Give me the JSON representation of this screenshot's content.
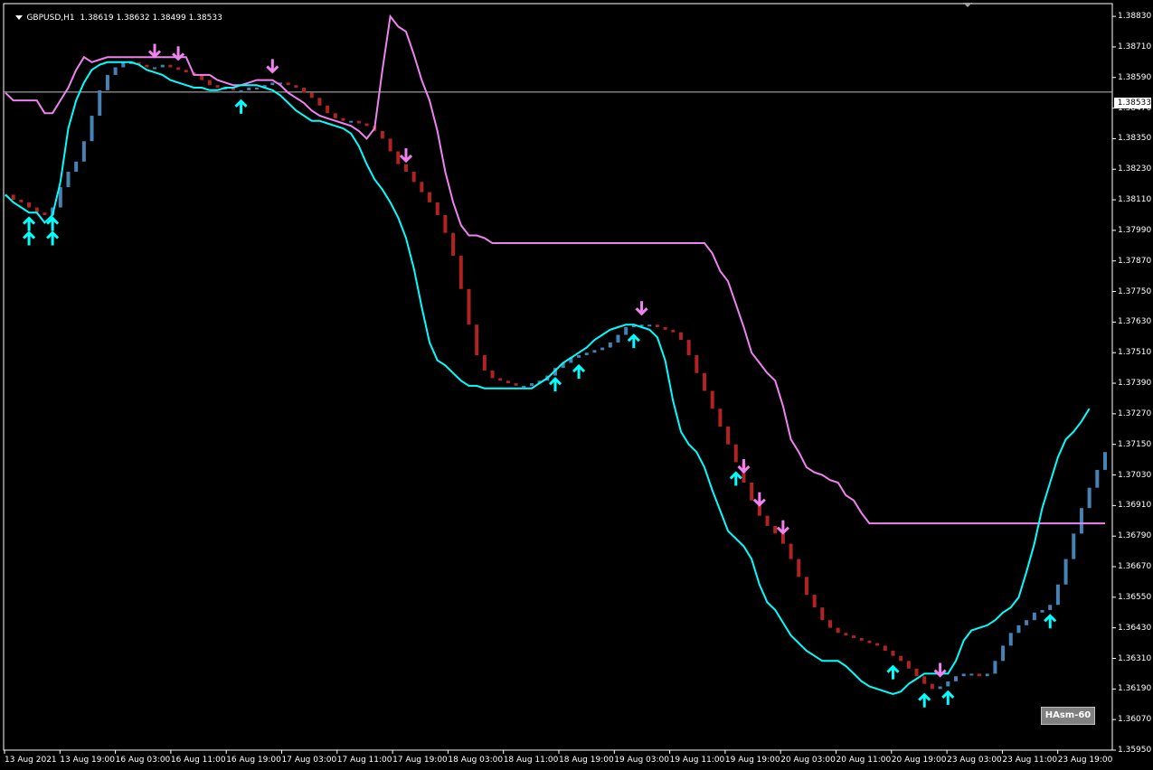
{
  "header": {
    "symbol_timeframe": "GBPUSD,H1",
    "ohlc": "1.38619 1.38632 1.38499 1.38533"
  },
  "price_axis": {
    "ticks": [
      "1.38830",
      "1.38710",
      "1.38590",
      "1.38470",
      "1.38350",
      "1.38230",
      "1.38110",
      "1.37990",
      "1.37870",
      "1.37750",
      "1.37630",
      "1.37510",
      "1.37390",
      "1.37270",
      "1.37150",
      "1.37030",
      "1.36910",
      "1.36790",
      "1.36670",
      "1.36550",
      "1.36430",
      "1.36310",
      "1.36190",
      "1.36070",
      "1.35950"
    ],
    "current_price": "1.38533"
  },
  "time_axis": {
    "ticks": [
      "13 Aug 2021",
      "13 Aug 19:00",
      "16 Aug 03:00",
      "16 Aug 11:00",
      "16 Aug 19:00",
      "17 Aug 03:00",
      "17 Aug 11:00",
      "17 Aug 19:00",
      "18 Aug 03:00",
      "18 Aug 11:00",
      "18 Aug 19:00",
      "19 Aug 03:00",
      "19 Aug 11:00",
      "19 Aug 19:00",
      "20 Aug 03:00",
      "20 Aug 11:00",
      "20 Aug 19:00",
      "23 Aug 03:00",
      "23 Aug 11:00",
      "23 Aug 19:00"
    ]
  },
  "indicator": {
    "label": "HAsm-60"
  },
  "colors": {
    "background": "#000000",
    "bull_bar": "#4682b4",
    "bear_bar": "#b22222",
    "upper_band": "#ee82ee",
    "lower_band": "#00ffff",
    "buy_arrow": "#00ffff",
    "sell_arrow": "#ee82ee",
    "axis": "#ffffff"
  },
  "chart_data": {
    "type": "candlestick",
    "series": [
      {
        "name": "GBPUSD,H1"
      }
    ],
    "y_range": [
      1.3595,
      1.3888
    ],
    "current_price": 1.38533,
    "ha_close": [
      1.3813,
      1.3811,
      1.381,
      1.3808,
      1.3806,
      1.3805,
      1.3808,
      1.3816,
      1.3822,
      1.3826,
      1.3834,
      1.3844,
      1.3854,
      1.386,
      1.3863,
      1.3865,
      1.3865,
      1.3864,
      1.3863,
      1.3863,
      1.3864,
      1.3863,
      1.3862,
      1.3861,
      1.386,
      1.3858,
      1.3856,
      1.3855,
      1.3855,
      1.3854,
      1.3854,
      1.3855,
      1.3855,
      1.3856,
      1.3857,
      1.3857,
      1.3856,
      1.3855,
      1.3853,
      1.3851,
      1.3848,
      1.3845,
      1.3843,
      1.3842,
      1.3842,
      1.3841,
      1.384,
      1.3838,
      1.3835,
      1.383,
      1.3825,
      1.3822,
      1.3818,
      1.3814,
      1.381,
      1.3805,
      1.3798,
      1.3789,
      1.3776,
      1.3762,
      1.375,
      1.3744,
      1.3741,
      1.374,
      1.3739,
      1.3738,
      1.3738,
      1.3739,
      1.374,
      1.3742,
      1.3745,
      1.3747,
      1.3749,
      1.375,
      1.3751,
      1.3752,
      1.3753,
      1.3755,
      1.3758,
      1.3761,
      1.3762,
      1.3762,
      1.3762,
      1.3761,
      1.376,
      1.3759,
      1.3756,
      1.375,
      1.3743,
      1.3736,
      1.3729,
      1.3722,
      1.3715,
      1.3708,
      1.37,
      1.3693,
      1.3687,
      1.3683,
      1.368,
      1.3676,
      1.367,
      1.3663,
      1.3656,
      1.3651,
      1.3646,
      1.3643,
      1.3641,
      1.364,
      1.3639,
      1.3638,
      1.3637,
      1.3636,
      1.3634,
      1.3632,
      1.363,
      1.3627,
      1.3624,
      1.3621,
      1.3619,
      1.362,
      1.3622,
      1.3624,
      1.3625,
      1.3625,
      1.3624,
      1.3625,
      1.363,
      1.3636,
      1.3641,
      1.3644,
      1.3646,
      1.3649,
      1.365,
      1.3652,
      1.366,
      1.367,
      1.368,
      1.369,
      1.3698,
      1.3705,
      1.3712
    ],
    "upper_band": [
      1.3853,
      1.385,
      1.385,
      1.385,
      1.385,
      1.3845,
      1.3845,
      1.385,
      1.3855,
      1.3862,
      1.3867,
      1.3865,
      1.3866,
      1.3867,
      1.3867,
      1.3867,
      1.3867,
      1.3867,
      1.3867,
      1.3867,
      1.3867,
      1.3867,
      1.3867,
      1.3867,
      1.386,
      1.386,
      1.386,
      1.3858,
      1.3857,
      1.3856,
      1.3856,
      1.3857,
      1.3858,
      1.3858,
      1.3858,
      1.3856,
      1.3853,
      1.3851,
      1.3849,
      1.3846,
      1.3844,
      1.3843,
      1.3842,
      1.3841,
      1.384,
      1.3838,
      1.3835,
      1.3839,
      1.3862,
      1.3883,
      1.3879,
      1.3877,
      1.3868,
      1.3858,
      1.385,
      1.3838,
      1.3822,
      1.381,
      1.3801,
      1.3797,
      1.3797,
      1.3796,
      1.3794,
      1.3794,
      1.3794,
      1.3794,
      1.3794,
      1.3794,
      1.3794,
      1.3794,
      1.3794,
      1.3794,
      1.3794,
      1.3794,
      1.3794,
      1.3794,
      1.3794,
      1.3794,
      1.3794,
      1.3794,
      1.3794,
      1.3794,
      1.3794,
      1.3794,
      1.3794,
      1.3794,
      1.3794,
      1.3794,
      1.3794,
      1.3794,
      1.379,
      1.3783,
      1.3779,
      1.377,
      1.3761,
      1.3751,
      1.3747,
      1.3743,
      1.374,
      1.373,
      1.3717,
      1.3712,
      1.3706,
      1.3704,
      1.3703,
      1.3701,
      1.37,
      1.3695,
      1.3693,
      1.3688,
      1.3684,
      1.3684,
      1.3684,
      1.3684,
      1.3684,
      1.3684,
      1.3684,
      1.3684,
      1.3684,
      1.3684,
      1.3684,
      1.3684,
      1.3684,
      1.3684,
      1.3684,
      1.3684,
      1.3684,
      1.3684,
      1.3684,
      1.3684,
      1.3684,
      1.3684,
      1.3684,
      1.3684,
      1.3684,
      1.3684,
      1.3684,
      1.3684,
      1.3684,
      1.3684,
      1.3684
    ],
    "lower_band": [
      1.3813,
      1.381,
      1.3808,
      1.3806,
      1.3806,
      1.3802,
      1.3805,
      1.3818,
      1.3839,
      1.385,
      1.3857,
      1.3862,
      1.3864,
      1.3865,
      1.3865,
      1.3865,
      1.3865,
      1.3864,
      1.3862,
      1.3861,
      1.386,
      1.3858,
      1.3857,
      1.3856,
      1.3855,
      1.3855,
      1.3854,
      1.3854,
      1.3855,
      1.3855,
      1.3856,
      1.3856,
      1.3856,
      1.3855,
      1.3854,
      1.3852,
      1.3849,
      1.3846,
      1.3844,
      1.3842,
      1.3842,
      1.3841,
      1.384,
      1.3839,
      1.3837,
      1.3832,
      1.3825,
      1.3819,
      1.3815,
      1.381,
      1.3804,
      1.3796,
      1.3784,
      1.3769,
      1.3755,
      1.3748,
      1.3746,
      1.3743,
      1.374,
      1.3738,
      1.3738,
      1.3737,
      1.3737,
      1.3737,
      1.3737,
      1.3737,
      1.3737,
      1.3737,
      1.3739,
      1.3741,
      1.3744,
      1.3747,
      1.3749,
      1.3751,
      1.3753,
      1.3756,
      1.3758,
      1.376,
      1.3761,
      1.3762,
      1.3762,
      1.3761,
      1.376,
      1.3757,
      1.3748,
      1.3732,
      1.372,
      1.3715,
      1.3712,
      1.3706,
      1.3697,
      1.3689,
      1.3681,
      1.3678,
      1.3675,
      1.367,
      1.366,
      1.3653,
      1.365,
      1.3645,
      1.364,
      1.3637,
      1.3634,
      1.3632,
      1.363,
      1.363,
      1.363,
      1.3628,
      1.3625,
      1.3622,
      1.362,
      1.3619,
      1.3618,
      1.3617,
      1.3618,
      1.3621,
      1.3623,
      1.3625,
      1.3625,
      1.3625,
      1.3625,
      1.363,
      1.3638,
      1.3642,
      1.3643,
      1.3644,
      1.3646,
      1.3649,
      1.3651,
      1.3655,
      1.3665,
      1.3676,
      1.369,
      1.37,
      1.371,
      1.3717,
      1.372,
      1.3724,
      1.3729
    ],
    "buy_arrows": [
      3,
      3,
      6,
      6,
      30,
      70,
      73,
      80,
      93,
      113,
      117,
      120,
      133
    ],
    "sell_arrows": [
      19,
      22,
      34,
      51,
      81,
      94,
      96,
      99,
      119
    ]
  }
}
